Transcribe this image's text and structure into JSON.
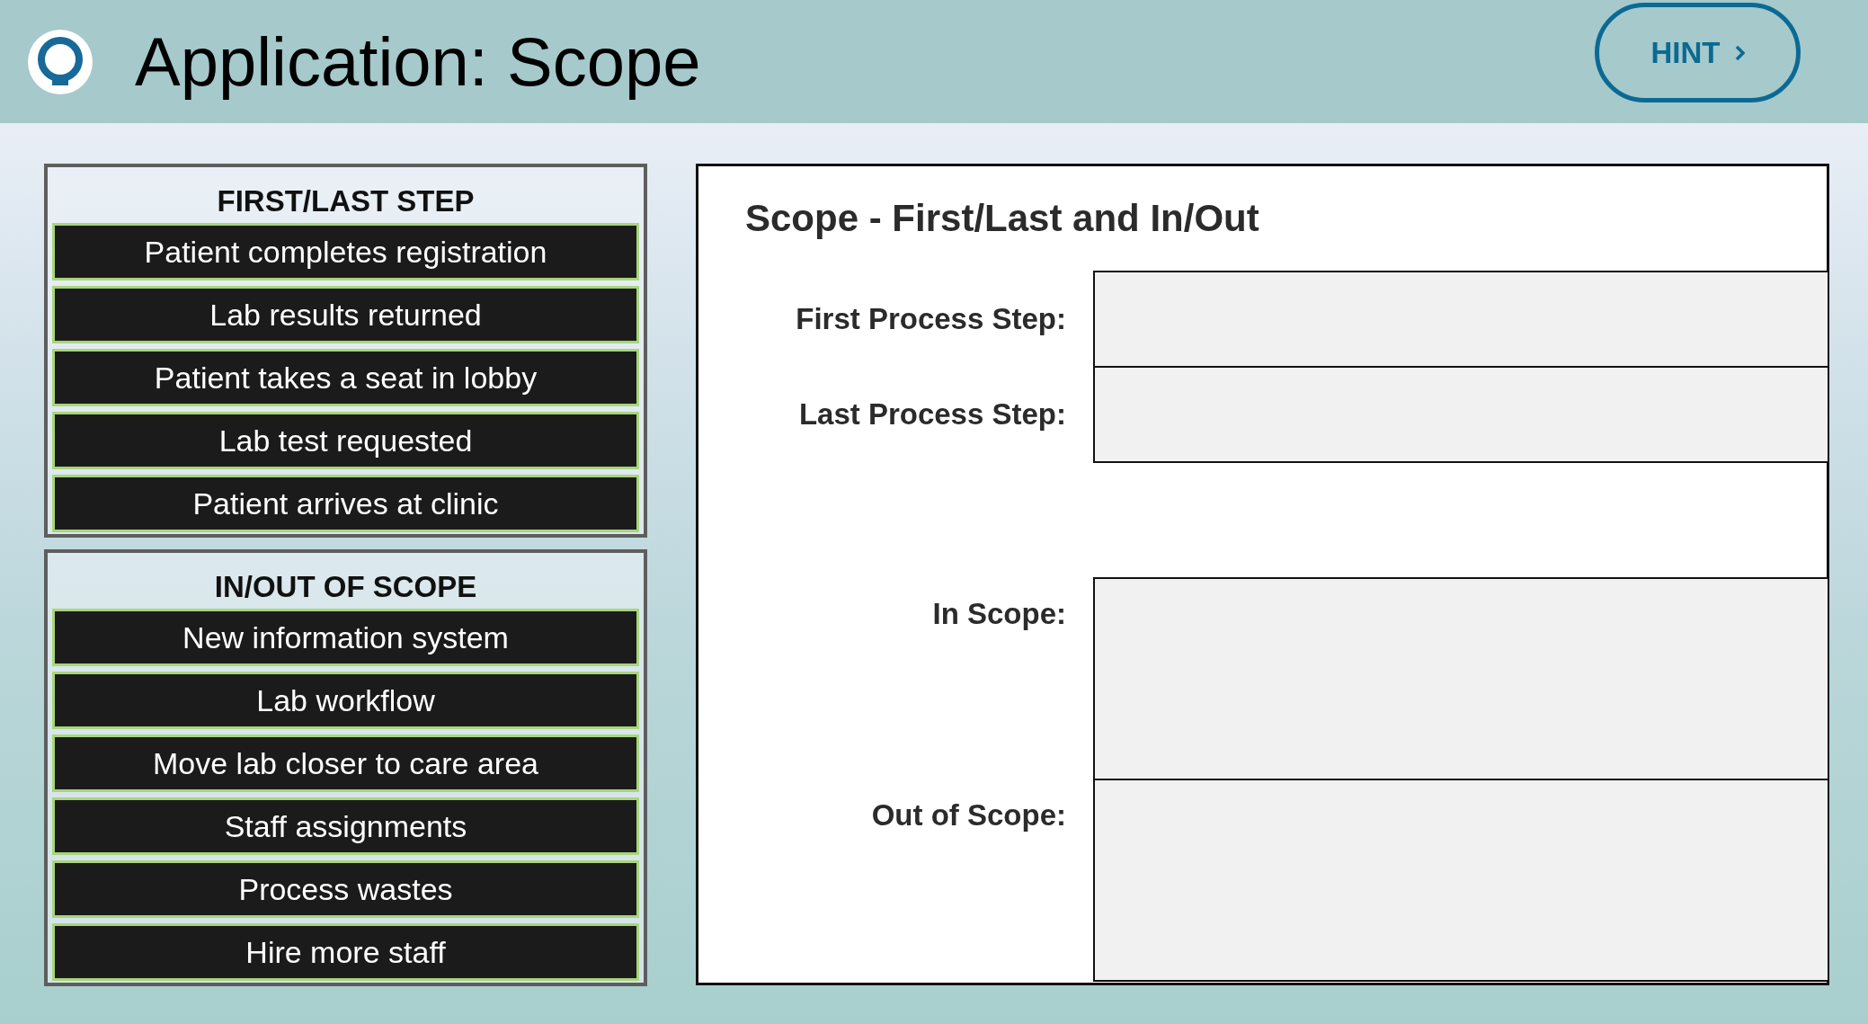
{
  "header": {
    "title": "Application: Scope",
    "hint_button": "HINT"
  },
  "groups": [
    {
      "title": "FIRST/LAST STEP",
      "items": [
        "Patient completes registration",
        "Lab results returned",
        "Patient takes a seat in lobby",
        "Lab test requested",
        "Patient arrives at clinic"
      ]
    },
    {
      "title": "IN/OUT OF SCOPE",
      "items": [
        "New information system",
        "Lab workflow",
        "Move lab closer to care area",
        "Staff assignments",
        "Process wastes",
        "Hire more staff"
      ]
    }
  ],
  "worksheet": {
    "title": "Scope - First/Last and In/Out",
    "fields": [
      {
        "label": "First Process Step:",
        "kind": "short"
      },
      {
        "label": "Last Process Step:",
        "kind": "short"
      },
      {
        "label": "In Scope:",
        "kind": "tall"
      },
      {
        "label": "Out of Scope:",
        "kind": "tall"
      }
    ]
  }
}
